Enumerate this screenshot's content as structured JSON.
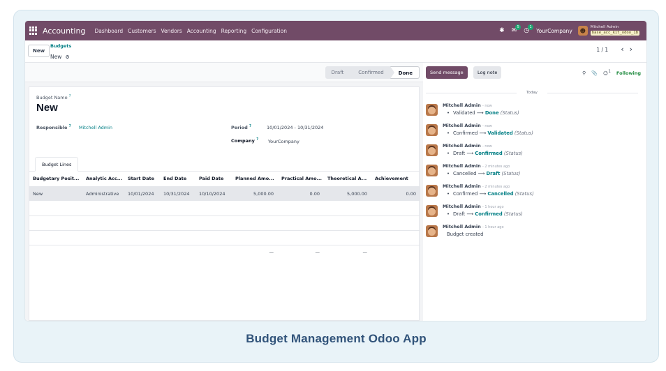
{
  "navbar": {
    "app_name": "Accounting",
    "menu": [
      "Dashboard",
      "Customers",
      "Vendors",
      "Accounting",
      "Reporting",
      "Configuration"
    ],
    "messages_badge": "5",
    "activity_badge": "1",
    "company": "YourCompany",
    "user_name": "Mitchell Admin",
    "database": "base_acc_kit_odoo_18"
  },
  "control_panel": {
    "new_label": "New",
    "breadcrumb_parent": "Budgets",
    "breadcrumb_current": "New",
    "pager": "1 / 1"
  },
  "statusbar": {
    "steps": [
      "Draft",
      "Confirmed",
      "Done"
    ],
    "active": "Done"
  },
  "form": {
    "name_label": "Budget Name",
    "name_value": "New",
    "responsible_label": "Responsible",
    "responsible_value": "Mitchell Admin",
    "period_label": "Period",
    "period_value": "10/01/2024 - 10/31/2024",
    "company_label": "Company",
    "company_value": "YourCompany",
    "help_mark": "?"
  },
  "tabs": {
    "active": "Budget Lines"
  },
  "budget_lines": {
    "columns": [
      "Budgetary Posit...",
      "Analytic Acc...",
      "Start Date",
      "End Date",
      "Paid Date",
      "Planned Amo...",
      "Practical Amo...",
      "Theoretical A...",
      "Achievement"
    ],
    "rows": [
      [
        "New",
        "Administrative",
        "10/01/2024",
        "10/31/2024",
        "10/10/2024",
        "5,000.00",
        "0.00",
        "5,000.00",
        "0.00"
      ]
    ],
    "totals": [
      "—",
      "—",
      "—"
    ]
  },
  "chatter": {
    "send_message": "Send message",
    "log_note": "Log note",
    "followers_count": "1",
    "following": "Following",
    "today": "Today",
    "messages": [
      {
        "author": "Mitchell Admin",
        "time": "- now",
        "from": "Validated",
        "to": "Done",
        "field": "(Status)"
      },
      {
        "author": "Mitchell Admin",
        "time": "- now",
        "from": "Confirmed",
        "to": "Validated",
        "field": "(Status)"
      },
      {
        "author": "Mitchell Admin",
        "time": "- now",
        "from": "Draft",
        "to": "Confirmed",
        "field": "(Status)"
      },
      {
        "author": "Mitchell Admin",
        "time": "- 2 minutes ago",
        "from": "Cancelled",
        "to": "Draft",
        "field": "(Status)"
      },
      {
        "author": "Mitchell Admin",
        "time": "- 2 minutes ago",
        "from": "Confirmed",
        "to": "Cancelled",
        "field": "(Status)"
      },
      {
        "author": "Mitchell Admin",
        "time": "- 1 hour ago",
        "from": "Draft",
        "to": "Confirmed",
        "field": "(Status)"
      },
      {
        "author": "Mitchell Admin",
        "time": "- 1 hour ago",
        "text": "Budget created"
      }
    ]
  },
  "caption": "Budget Management Odoo App"
}
